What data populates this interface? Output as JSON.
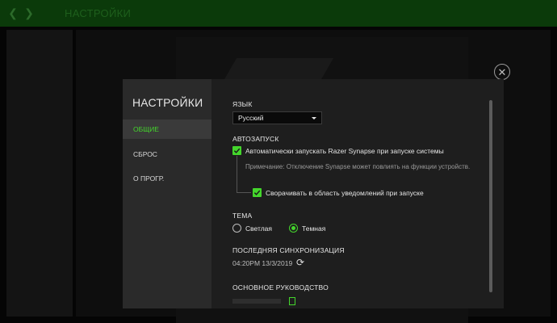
{
  "topbar": {
    "title": "НАСТРОЙКИ"
  },
  "dialog": {
    "title": "НАСТРОЙКИ",
    "sidebar": {
      "items": [
        {
          "label": "ОБЩИЕ",
          "active": true
        },
        {
          "label": "СБРОС",
          "active": false
        },
        {
          "label": "О ПРОГР.",
          "active": false
        }
      ]
    },
    "language": {
      "label": "ЯЗЫК",
      "value": "Русский"
    },
    "autostart": {
      "label": "АВТОЗАПУСК",
      "launch_checkbox": {
        "label": "Автоматически запускать Razer Synapse при запуске системы",
        "checked": true
      },
      "note": "Примечание: Отключение Synapse может повлиять на функции устройств.",
      "minimize_checkbox": {
        "label": "Сворачивать в область уведомлений при запуске",
        "checked": true
      }
    },
    "theme": {
      "label": "ТЕМА",
      "options": [
        {
          "label": "Светлая",
          "selected": false
        },
        {
          "label": "Темная",
          "selected": true
        }
      ]
    },
    "sync": {
      "label": "ПОСЛЕДНЯЯ СИНХРОНИЗАЦИЯ",
      "time": "04:20PM 13/3/2019"
    },
    "guide": {
      "label": "ОСНОВНОЕ РУКОВОДСТВО"
    }
  },
  "colors": {
    "accent": "#44d62c",
    "panel": "#1e1e1e",
    "sidebar": "#2a2a2a",
    "topbar": "#0b3a0a"
  },
  "icons": {
    "close": "close-circle-icon",
    "back": "chevron-left-icon",
    "forward": "chevron-right-icon",
    "sync": "refresh-icon"
  }
}
